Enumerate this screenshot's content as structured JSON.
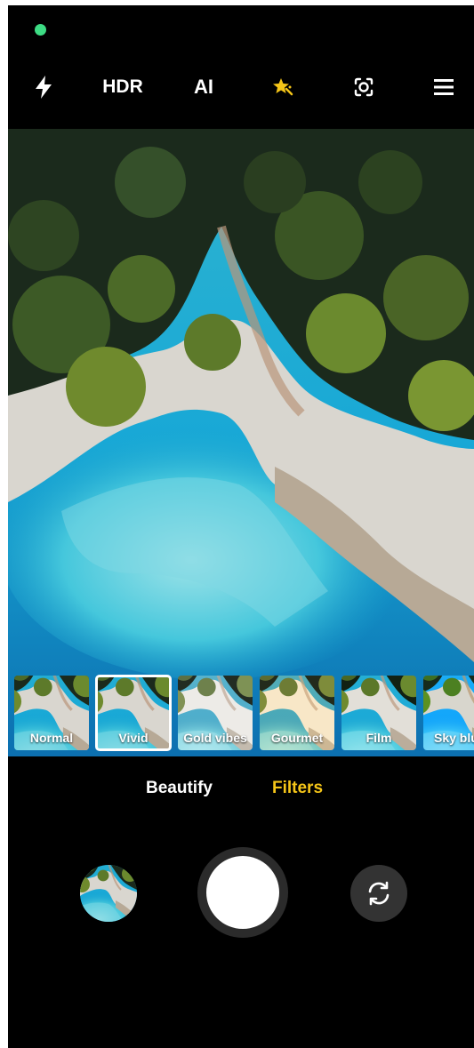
{
  "top_bar": {
    "flash_icon": "lightning-bolt-icon",
    "hdr_label": "HDR",
    "ai_label": "AI",
    "beauty_icon": "sparkle-star-icon",
    "lens_icon": "lens-focus-icon",
    "menu_icon": "hamburger-menu-icon"
  },
  "filters": [
    {
      "label": "Normal",
      "selected": false
    },
    {
      "label": "Vivid",
      "selected": true
    },
    {
      "label": "Gold vibes",
      "selected": false
    },
    {
      "label": "Gourmet",
      "selected": false
    },
    {
      "label": "Film",
      "selected": false
    },
    {
      "label": "Sky blue",
      "selected": false
    }
  ],
  "modes": {
    "beautify_label": "Beautify",
    "filters_label": "Filters",
    "active": "Filters"
  },
  "controls": {
    "gallery_icon": "gallery-thumbnail",
    "shutter_icon": "shutter-button",
    "switch_icon": "switch-camera-icon"
  },
  "colors": {
    "accent": "#F5C518",
    "status_dot": "#3DDC84",
    "background": "#000000"
  }
}
